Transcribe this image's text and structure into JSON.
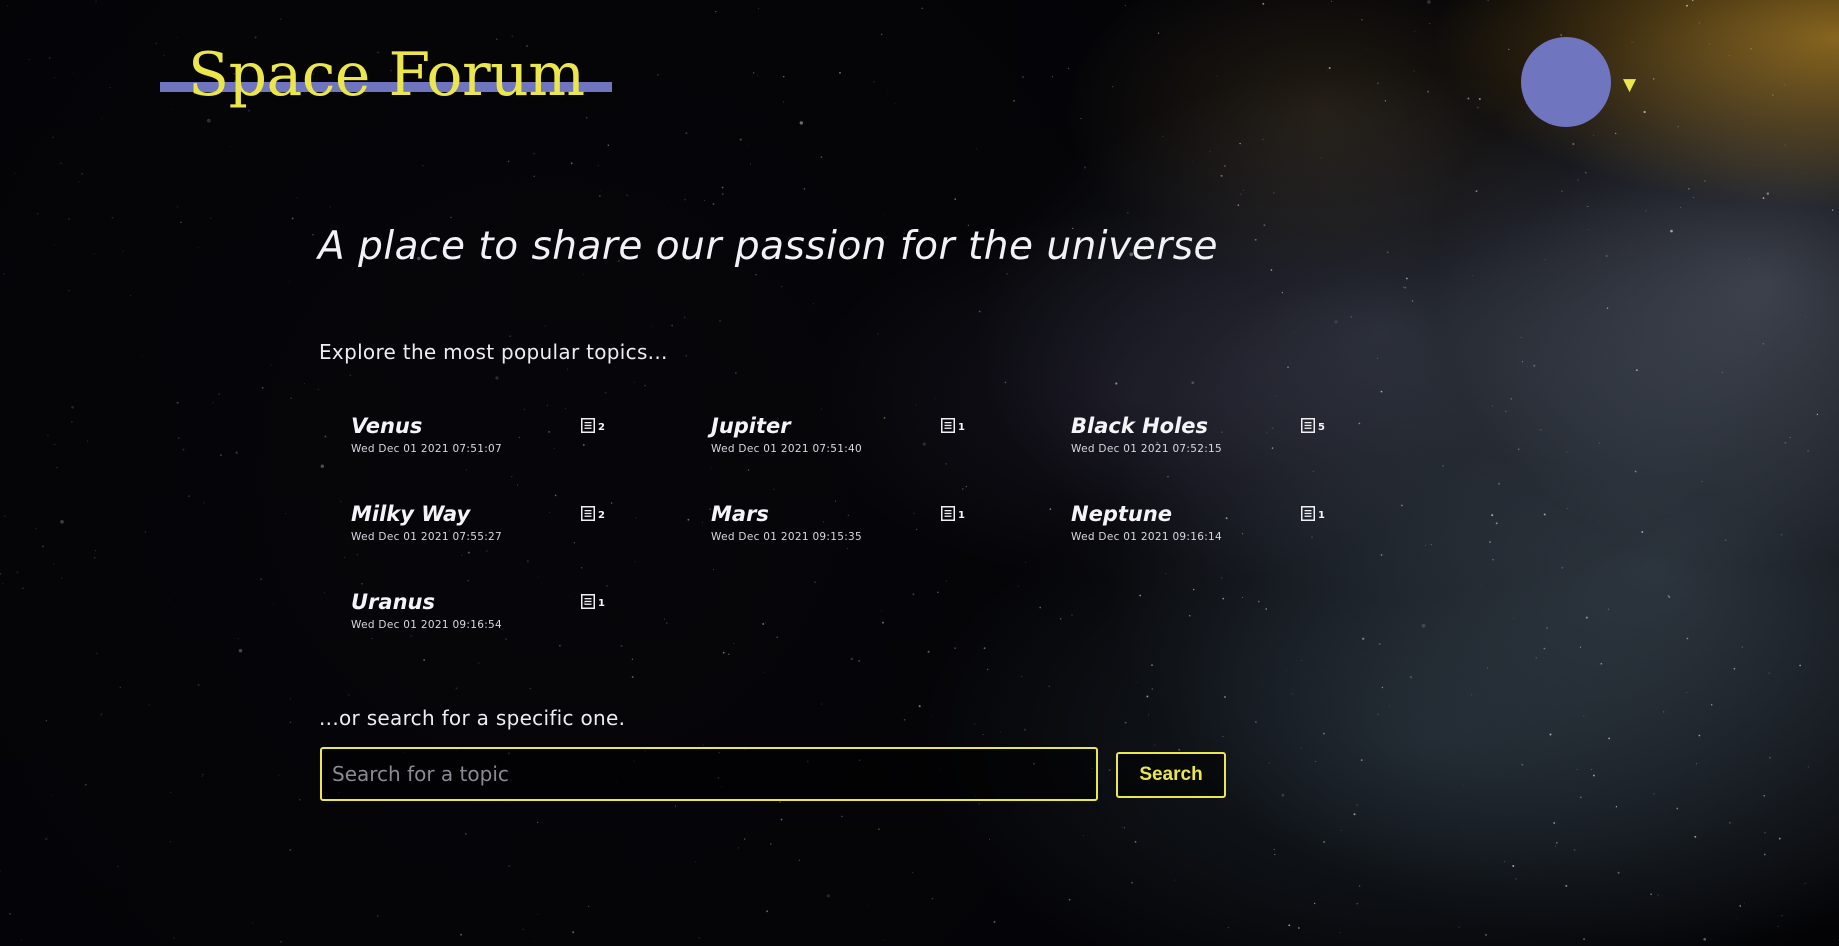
{
  "header": {
    "logo_text": "Space Forum",
    "user_menu_caret": "▼"
  },
  "hero": {
    "tagline": "A place to share our passion for the universe"
  },
  "topics_section": {
    "label": "Explore the most popular topics...",
    "topics": [
      {
        "name": "Venus",
        "date": "Wed Dec 01 2021 07:51:07",
        "post_count": "2"
      },
      {
        "name": "Jupiter",
        "date": "Wed Dec 01 2021 07:51:40",
        "post_count": "1"
      },
      {
        "name": "Black Holes",
        "date": "Wed Dec 01 2021 07:52:15",
        "post_count": "5"
      },
      {
        "name": "Milky Way",
        "date": "Wed Dec 01 2021 07:55:27",
        "post_count": "2"
      },
      {
        "name": "Mars",
        "date": "Wed Dec 01 2021 09:15:35",
        "post_count": "1"
      },
      {
        "name": "Neptune",
        "date": "Wed Dec 01 2021 09:16:14",
        "post_count": "1"
      },
      {
        "name": "Uranus",
        "date": "Wed Dec 01 2021 09:16:54",
        "post_count": "1"
      }
    ]
  },
  "search": {
    "label": "...or search for a specific one.",
    "placeholder": "Search for a topic",
    "value": "",
    "button_label": "Search"
  },
  "colors": {
    "accent_yellow": "#ece64d",
    "accent_purple": "#7075c0",
    "background": "#040406"
  },
  "icons": {
    "post_count": "document-icon",
    "user_menu": "chevron-down-icon"
  }
}
